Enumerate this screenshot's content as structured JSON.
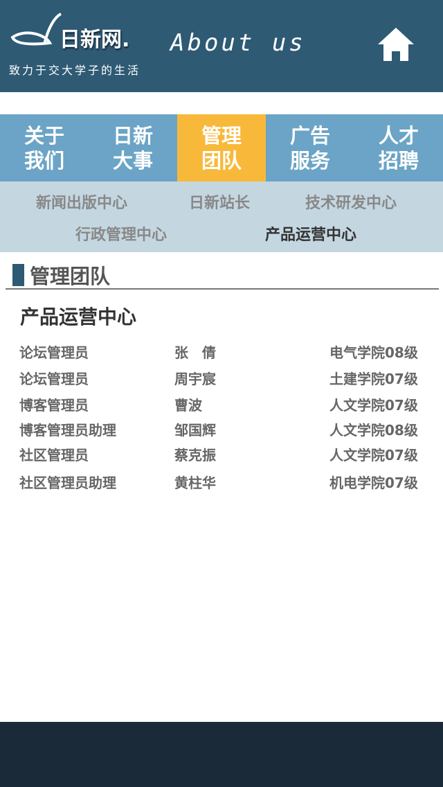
{
  "header": {
    "logo_text": "日新网.",
    "slogan": "致力于交大学子的生活",
    "title": "About us",
    "home_icon": "home-icon"
  },
  "nav": [
    {
      "label": "关于我们"
    },
    {
      "label": "日新大事"
    },
    {
      "label": "管理团队",
      "active": true
    },
    {
      "label": "广告服务"
    },
    {
      "label": "人才招聘"
    }
  ],
  "subnav": [
    "新闻出版中心",
    "日新站长",
    "技术研发中心",
    "行政管理中心",
    "产品运营中心"
  ],
  "section": {
    "title": "管理团队",
    "subtitle": "产品运营中心"
  },
  "members": [
    {
      "role": "论坛管理员",
      "name": "张　倩",
      "college": "电气学院08级"
    },
    {
      "role": "论坛管理员",
      "name": "周宇宸",
      "college": "土建学院07级"
    },
    {
      "role": "博客管理员",
      "name": "曹波",
      "college": "人文学院07级"
    },
    {
      "role": "博客管理员助理",
      "name": "邹国辉",
      "college": "人文学院08级"
    },
    {
      "role": "社区管理员",
      "name": "蔡克振",
      "college": "人文学院07级"
    },
    {
      "role": "社区管理员助理",
      "name": "黄柱华",
      "college": "机电学院07级"
    }
  ]
}
